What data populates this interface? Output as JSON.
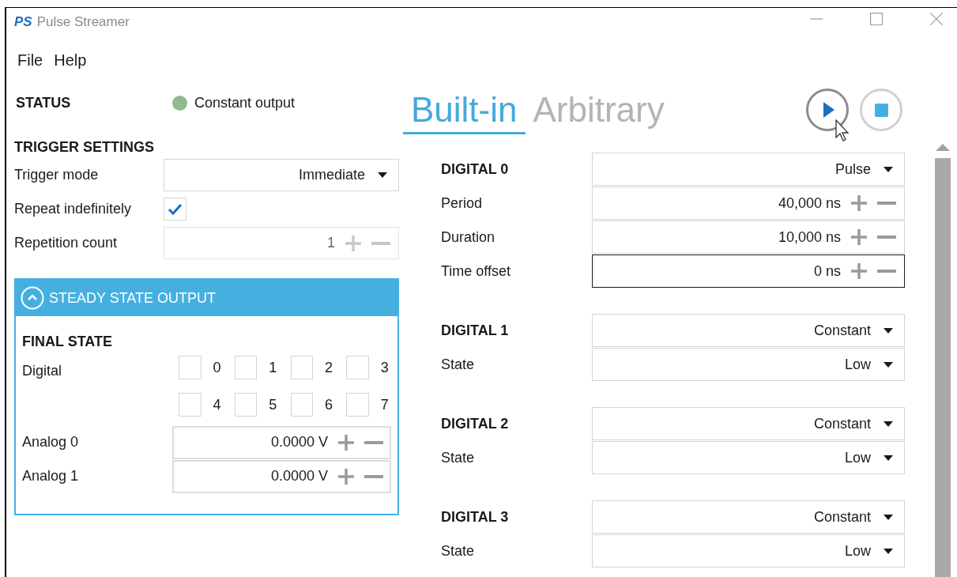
{
  "window": {
    "logo": "PS",
    "title": "Pulse Streamer"
  },
  "menu": [
    "File",
    "Help"
  ],
  "status": {
    "label": "STATUS",
    "color": "#8fbc8f",
    "text": "Constant output"
  },
  "trigger": {
    "heading": "TRIGGER SETTINGS",
    "mode_label": "Trigger mode",
    "mode_value": "Immediate",
    "repeat_label": "Repeat indefinitely",
    "repeat_checked": true,
    "count_label": "Repetition count",
    "count_value": "1",
    "count_disabled": true
  },
  "steady": {
    "title": "STEADY STATE OUTPUT",
    "expanded": true,
    "final_heading": "FINAL STATE",
    "digital_label": "Digital",
    "bits": [
      {
        "label": "0",
        "checked": false
      },
      {
        "label": "1",
        "checked": false
      },
      {
        "label": "2",
        "checked": false
      },
      {
        "label": "3",
        "checked": false
      },
      {
        "label": "4",
        "checked": false
      },
      {
        "label": "5",
        "checked": false
      },
      {
        "label": "6",
        "checked": false
      },
      {
        "label": "7",
        "checked": false
      }
    ],
    "analog": [
      {
        "label": "Analog 0",
        "value": "0.0000 V"
      },
      {
        "label": "Analog 1",
        "value": "0.0000 V"
      }
    ]
  },
  "tabs": [
    {
      "label": "Built-in",
      "selected": true
    },
    {
      "label": "Arbitrary",
      "selected": false
    }
  ],
  "channels": [
    {
      "name": "DIGITAL 0",
      "mode": "Pulse",
      "fields": [
        {
          "kind": "spin",
          "label": "Period",
          "value": "40,000 ns",
          "focused": false
        },
        {
          "kind": "spin",
          "label": "Duration",
          "value": "10,000 ns",
          "focused": false
        },
        {
          "kind": "spin",
          "label": "Time offset",
          "value": "0 ns",
          "focused": true
        }
      ]
    },
    {
      "name": "DIGITAL 1",
      "mode": "Constant",
      "fields": [
        {
          "kind": "select",
          "label": "State",
          "value": "Low",
          "focused": false
        }
      ]
    },
    {
      "name": "DIGITAL 2",
      "mode": "Constant",
      "fields": [
        {
          "kind": "select",
          "label": "State",
          "value": "Low",
          "focused": false
        }
      ]
    },
    {
      "name": "DIGITAL 3",
      "mode": "Constant",
      "fields": [
        {
          "kind": "select",
          "label": "State",
          "value": "Low",
          "focused": false
        }
      ]
    }
  ]
}
